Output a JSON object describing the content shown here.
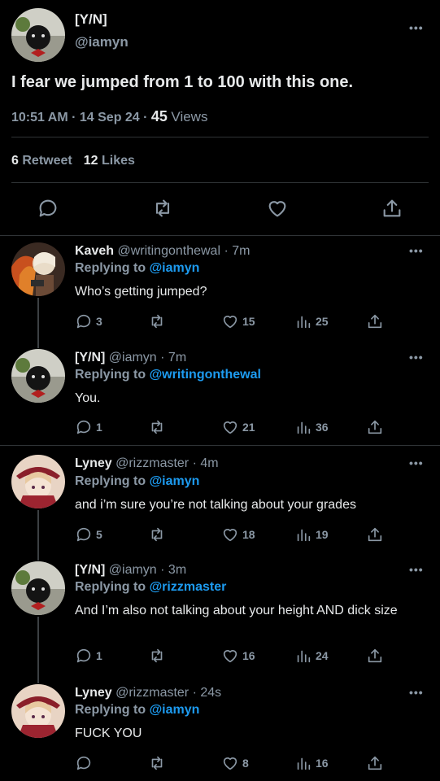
{
  "main": {
    "author_name": "[Y/N]",
    "author_handle": "@iamyn",
    "text": "I fear we jumped from 1 to 100 with this one.",
    "time": "10:51 AM · 14 Sep 24 · ",
    "views_count": "45",
    "views_label": "Views",
    "retweet_count": "6",
    "retweet_label": "Retweet",
    "likes_count": "12",
    "likes_label": "Likes",
    "more": "•••"
  },
  "replies": [
    {
      "name": "Kaveh",
      "handle": "@writingonthewal · 7m",
      "replying_prefix": "Replying to ",
      "replying_to": "@iamyn",
      "text": "Who’s getting jumped?",
      "comments": "3",
      "retweets": "",
      "likes": "15",
      "views": "25"
    },
    {
      "name": "[Y/N]",
      "handle": "@iamyn · 7m",
      "replying_prefix": "Replying to ",
      "replying_to": "@writingonthewal",
      "text": "You.",
      "comments": "1",
      "retweets": "",
      "likes": "21",
      "views": "36"
    },
    {
      "name": "Lyney",
      "handle": "@rizzmaster · 4m",
      "replying_prefix": "Replying to ",
      "replying_to": "@iamyn",
      "text": "and i’m sure you’re not talking about your grades",
      "comments": "5",
      "retweets": "",
      "likes": "18",
      "views": "19"
    },
    {
      "name": "[Y/N]",
      "handle": "@iamyn · 3m",
      "replying_prefix": "Replying to ",
      "replying_to": "@rizzmaster",
      "text": "And I’m also not talking about your height AND dick size",
      "comments": "1",
      "retweets": "",
      "likes": "16",
      "views": "24"
    },
    {
      "name": "Lyney",
      "handle": "@rizzmaster · 24s",
      "replying_prefix": "Replying to ",
      "replying_to": "@iamyn",
      "text": "FUCK YOU",
      "comments": "",
      "retweets": "",
      "likes": "8",
      "views": "16"
    }
  ],
  "colors": {
    "link": "#1d9bf0",
    "muted": "#8b98a5",
    "text": "#e7e9ea",
    "bg": "#000000"
  },
  "icons": [
    "comment-icon",
    "retweet-icon",
    "like-icon",
    "views-icon",
    "share-icon",
    "more-icon"
  ]
}
